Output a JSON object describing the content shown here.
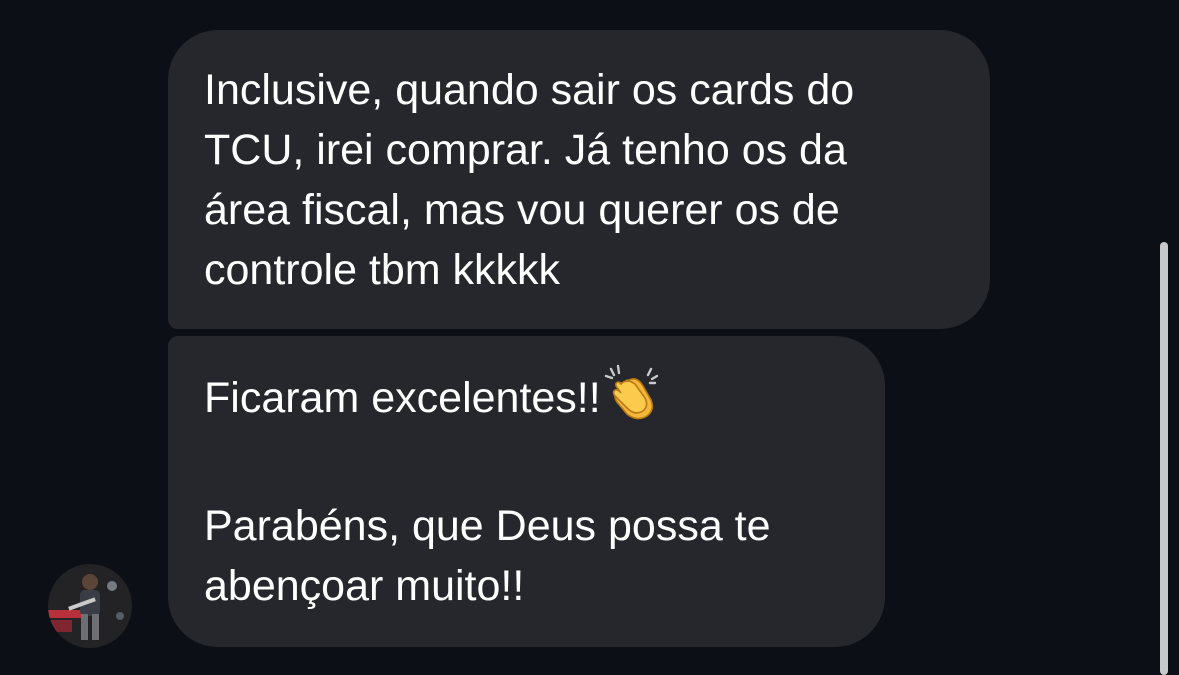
{
  "messages": [
    {
      "text": "Inclusive, quando sair os cards do\nTCU, irei comprar. Já tenho os da\nárea fiscal, mas vou querer os de\ncontrole tbm kkkkk"
    },
    {
      "line1": "Ficaram excelentes!!",
      "emoji": "clapping-hands-icon",
      "line2": "Parabéns, que Deus possa te",
      "line3": "abençoar muito!!"
    }
  ],
  "colors": {
    "background": "#0c0f15",
    "bubble": "#25272c",
    "text": "#ffffff",
    "scrollbar": "#c9c9c9"
  }
}
